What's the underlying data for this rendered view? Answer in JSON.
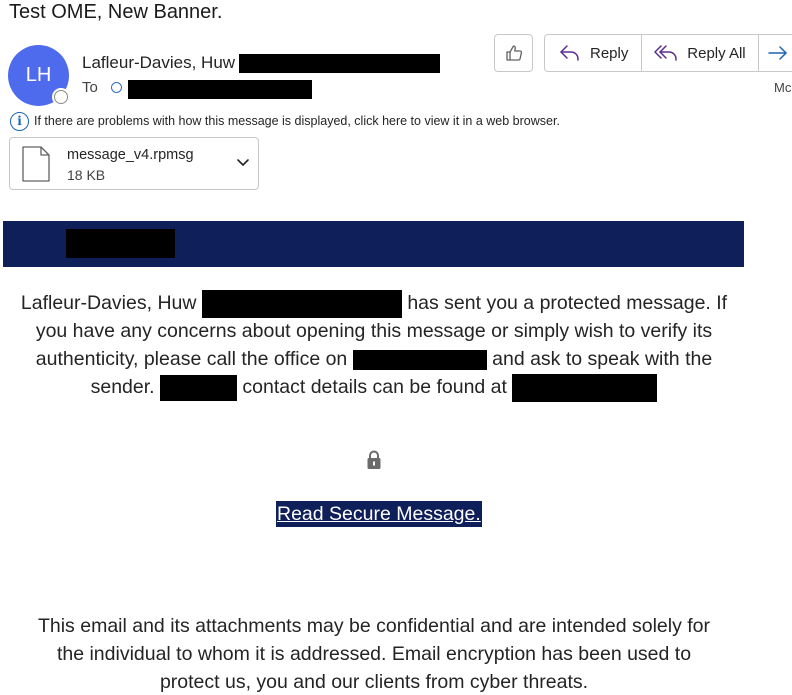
{
  "message": {
    "subject": "Test OME, New Banner.",
    "sender_initials": "LH",
    "sender_name": "Lafleur-Davies, Huw",
    "to_label": "To"
  },
  "actions": {
    "reply": "Reply",
    "reply_all": "Reply All",
    "more": "Mc"
  },
  "info_bar": {
    "text": "If there are problems with how this message is displayed, click here to view it in a web browser."
  },
  "attachment": {
    "name": "message_v4.rpmsg",
    "size": "18 KB"
  },
  "body": {
    "line1_a": "Lafleur-Davies, Huw",
    "line1_b": "has sent you a protected message. If",
    "line2": "you have any concerns about opening this message or simply wish to verify its",
    "line3_a": "authenticity, please call the office on",
    "line3_b": "and ask to speak with the",
    "line4_a": "sender.",
    "line4_b": "contact details can be found at"
  },
  "secure_link": "Read Secure Message.",
  "footer": {
    "line1": "This email and its attachments may be confidential and are intended solely for",
    "line2": "the individual to whom it is addressed. Email encryption has been used to",
    "line3": "protect us, you and our clients from cyber threats."
  },
  "colors": {
    "avatar": "#4f6bed",
    "banner": "#0f1f5a",
    "accent": "#1a63b5",
    "redaction": "#000000"
  }
}
